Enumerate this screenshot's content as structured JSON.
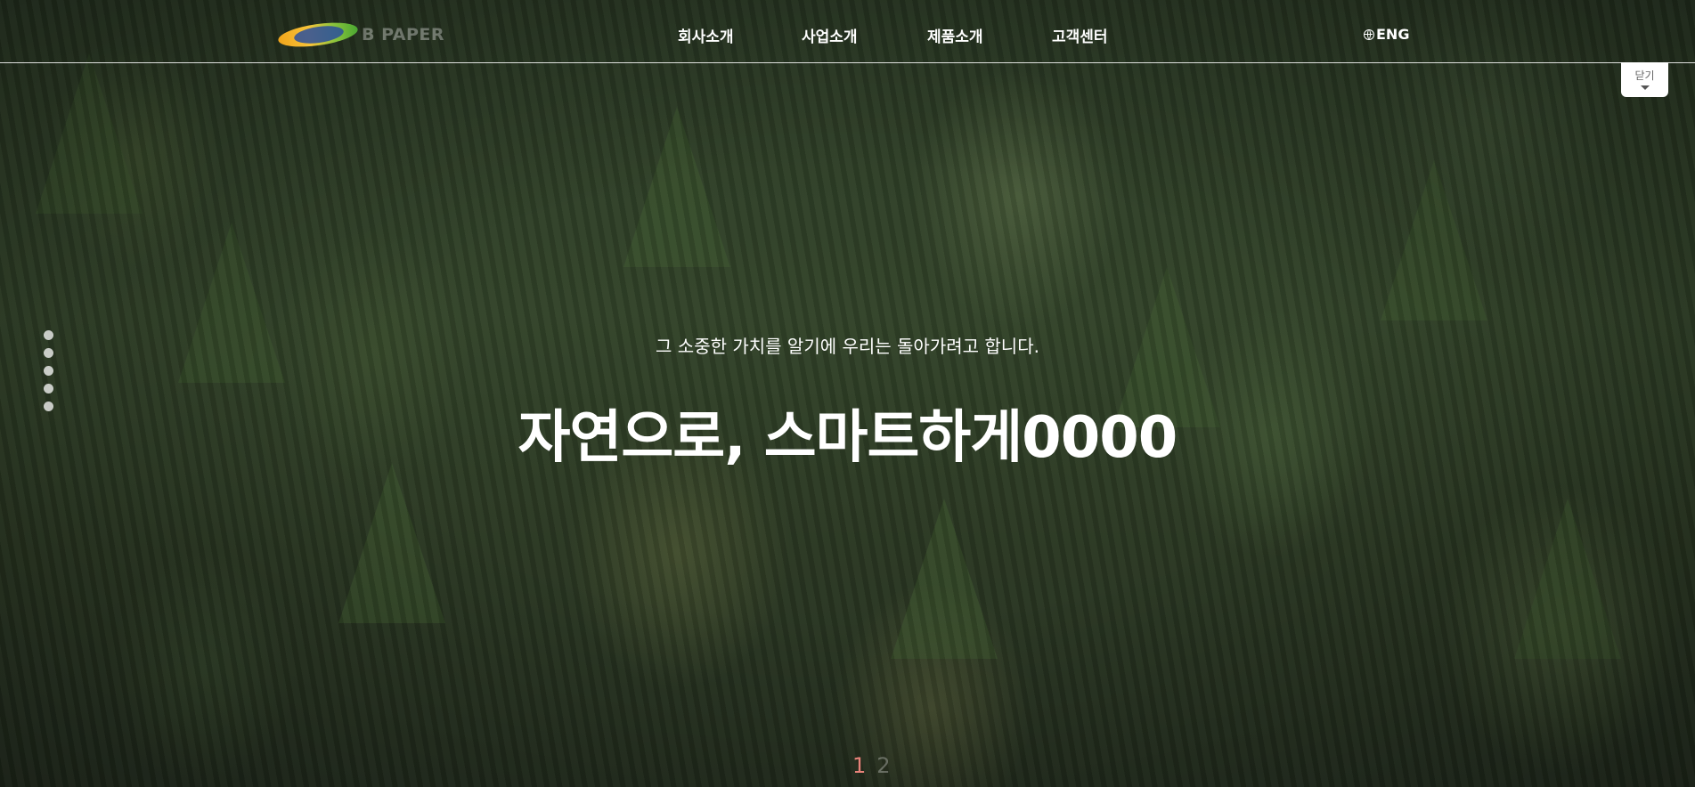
{
  "header": {
    "logo_text": "B PAPER",
    "nav": [
      {
        "label": "회사소개"
      },
      {
        "label": "사업소개"
      },
      {
        "label": "제품소개"
      },
      {
        "label": "고객센터"
      }
    ],
    "language_label": "ENG",
    "close_label": "닫기"
  },
  "hero": {
    "subtitle": "그 소중한 가치를 알기에 우리는 돌아가려고 합니다.",
    "title": "자연으로, 스마트하게0000"
  },
  "pagination": {
    "current": "1",
    "next": "2"
  },
  "section_dots_count": 5,
  "colors": {
    "accent": "#e8837a",
    "header_line": "#ffffff",
    "text": "#ffffff"
  },
  "icons": [
    "globe-icon",
    "caret-down-icon"
  ]
}
